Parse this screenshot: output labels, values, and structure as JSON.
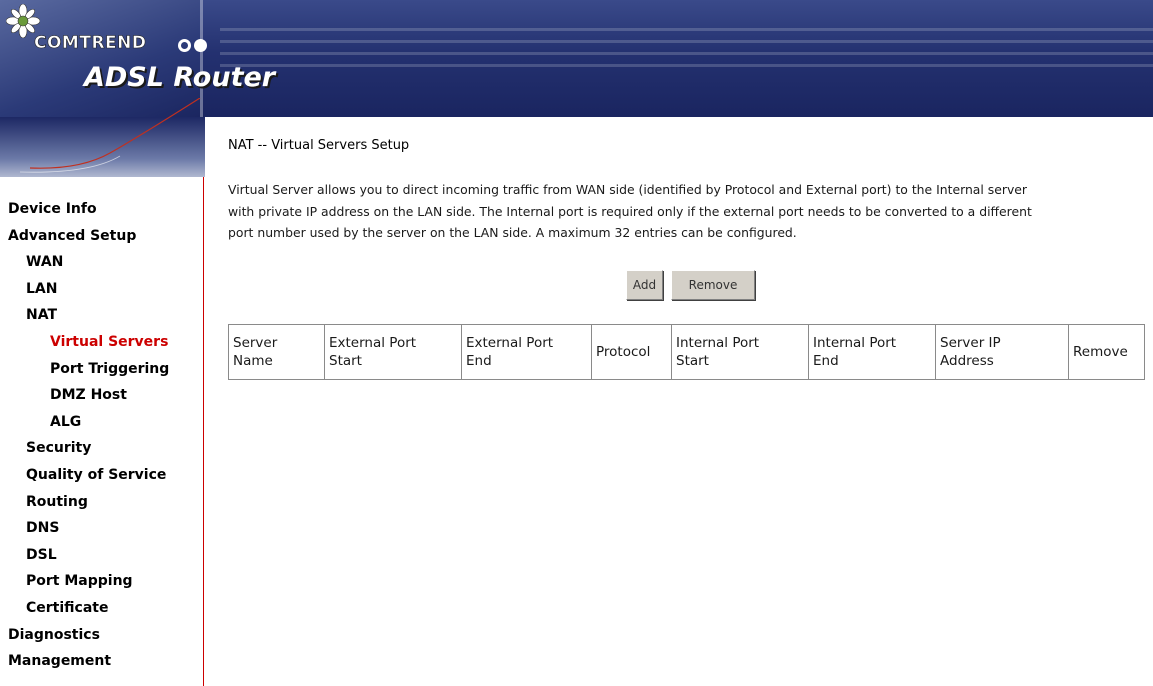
{
  "header": {
    "brand": "COMTREND",
    "product": "ADSL Router"
  },
  "sidebar": {
    "items": [
      {
        "label": "Device Info",
        "level": 0,
        "active": false
      },
      {
        "label": "Advanced Setup",
        "level": 0,
        "active": false
      },
      {
        "label": "WAN",
        "level": 1,
        "active": false
      },
      {
        "label": "LAN",
        "level": 1,
        "active": false
      },
      {
        "label": "NAT",
        "level": 1,
        "active": false
      },
      {
        "label": "Virtual Servers",
        "level": 2,
        "active": true
      },
      {
        "label": "Port Triggering",
        "level": 2,
        "active": false
      },
      {
        "label": "DMZ Host",
        "level": 2,
        "active": false
      },
      {
        "label": "ALG",
        "level": 2,
        "active": false
      },
      {
        "label": "Security",
        "level": 1,
        "active": false
      },
      {
        "label": "Quality of Service",
        "level": 1,
        "active": false
      },
      {
        "label": "Routing",
        "level": 1,
        "active": false
      },
      {
        "label": "DNS",
        "level": 1,
        "active": false
      },
      {
        "label": "DSL",
        "level": 1,
        "active": false
      },
      {
        "label": "Port Mapping",
        "level": 1,
        "active": false
      },
      {
        "label": "Certificate",
        "level": 1,
        "active": false
      },
      {
        "label": "Diagnostics",
        "level": 0,
        "active": false
      },
      {
        "label": "Management",
        "level": 0,
        "active": false
      }
    ]
  },
  "main": {
    "title": "NAT -- Virtual Servers Setup",
    "description": [
      "Virtual Server allows you to direct incoming traffic from WAN side (identified by Protocol and External port) to the Internal server",
      "with private IP address on the LAN side. The Internal port is required only if the external port needs to be converted to a different",
      "port number used by the server on the LAN side. A maximum 32 entries can be configured."
    ],
    "add_label": "Add",
    "remove_label": "Remove",
    "table": {
      "columns": [
        [
          "Server",
          "Name"
        ],
        [
          "External Port",
          "Start"
        ],
        [
          "External Port",
          "End"
        ],
        [
          "Protocol"
        ],
        [
          "Internal Port",
          "Start"
        ],
        [
          "Internal Port",
          "End"
        ],
        [
          "Server IP",
          "Address"
        ],
        [
          "Remove"
        ]
      ]
    }
  },
  "colors": {
    "header_blue": "#243170",
    "active_link": "#cc0000",
    "sidebar_border": "#cc0000",
    "button_face": "#d4d0c8"
  }
}
